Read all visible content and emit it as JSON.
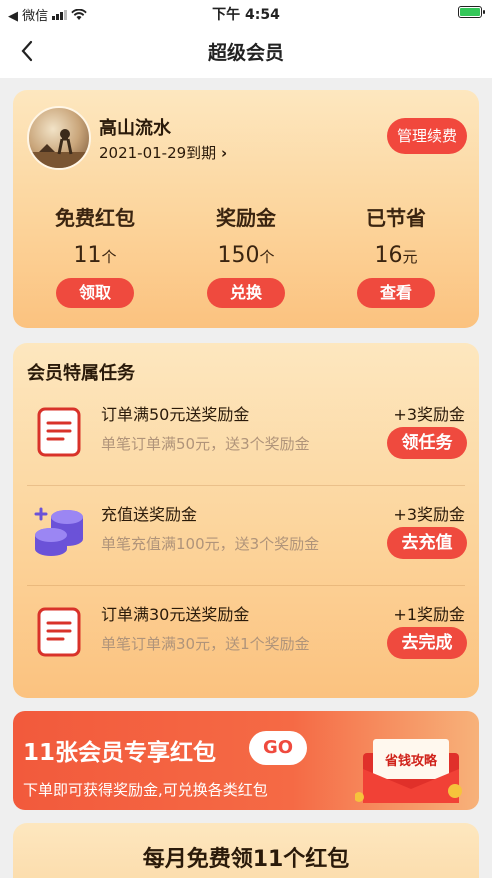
{
  "status_bar": {
    "carrier": "◀ 微信",
    "time": "下午 4:54"
  },
  "nav": {
    "title": "超级会员"
  },
  "member": {
    "name": "高山流水",
    "expire": "2021-01-29到期",
    "renew_label": "管理续费",
    "stats": [
      {
        "label": "免费红包",
        "value": "11",
        "unit": "个",
        "button": "领取"
      },
      {
        "label": "奖励金",
        "value": "150",
        "unit": "个",
        "button": "兑换"
      },
      {
        "label": "已节省",
        "value": "16",
        "unit": "元",
        "button": "查看"
      }
    ]
  },
  "tasks": {
    "title": "会员特属任务",
    "items": [
      {
        "icon": "document-icon",
        "name": "订单满50元送奖励金",
        "desc": "单笔订单满50元，送3个奖励金",
        "reward": "+3奖励金",
        "button": "领任务"
      },
      {
        "icon": "coins-icon",
        "name": "充值送奖励金",
        "desc": "单笔充值满100元，送3个奖励金",
        "reward": "+3奖励金",
        "button": "去充值"
      },
      {
        "icon": "document-icon",
        "name": "订单满30元送奖励金",
        "desc": "单笔订单满30元，送1个奖励金",
        "reward": "+1奖励金",
        "button": "去完成"
      }
    ]
  },
  "banner": {
    "title": "11张会员专享红包",
    "go": "GO",
    "subtitle": "下单即可获得奖励金,可兑换各类红包",
    "envelope_text": "省钱攻略"
  },
  "monthly": {
    "title": "每月免费领11个红包"
  },
  "colors": {
    "accent": "#ef4a3e",
    "card_top": "#fde7bf",
    "card_bottom": "#fbc27f",
    "purple_icon": "#6b52d8"
  }
}
